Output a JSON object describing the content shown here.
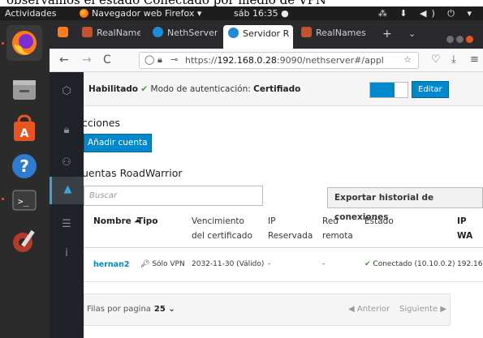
{
  "caption": "observamos el estado Conectado por medio de VPN",
  "topbar": {
    "activities": "Actividades",
    "app_menu": "Navegador web Firefox ▾",
    "clock": "sáb 16:35 ●",
    "tray": "⁂ ⬇ ◀) ⏻ ▾"
  },
  "browser": {
    "tabs": [
      {
        "label": "RealNames"
      },
      {
        "label": "NethServer"
      },
      {
        "label": "Servidor R"
      },
      {
        "label": "RealNames"
      }
    ],
    "url_prefix": "https://",
    "url_host": "192.168.0.28",
    "url_rest": ":9090/nethserver#/appl"
  },
  "status": {
    "label_enabled": "Habilitado",
    "check": "✔",
    "auth_mode_label": "Modo de autenticación:",
    "auth_mode_value": "Certifiado",
    "edit_button": "Editar",
    "toggle_on": true
  },
  "actions": {
    "heading": "cciones",
    "add_account": "Añadir cuenta"
  },
  "roadwarrior": {
    "heading": "uentas RoadWarrior",
    "search_placeholder": "Buscar",
    "export_button": "Exportar historial de conexiones"
  },
  "table": {
    "headers": [
      {
        "line1": "Nombre ⏶",
        "line2": ""
      },
      {
        "line1": "Tipo",
        "line2": ""
      },
      {
        "line1": "Vencimiento",
        "line2": "del certificado"
      },
      {
        "line1": "IP",
        "line2": "Reservada"
      },
      {
        "line1": "Red",
        "line2": "remota"
      },
      {
        "line1": "Estado",
        "line2": ""
      },
      {
        "line1": "IP WA",
        "line2": ""
      }
    ],
    "rows": [
      {
        "name": "hernan2",
        "type": "Sólo VPN",
        "expiry": "2032-11-30 (Válido)",
        "reserved_ip": "-",
        "remote_net": "-",
        "state": "Conectado (10.10.0.2)",
        "wan_ip": "192.16"
      }
    ]
  },
  "pagination": {
    "rows_per_page_label": "Filas por pagina",
    "rows_per_page_value": "25 ⌄",
    "previous": "◀ Anterior",
    "next": "Siguiente ▶"
  }
}
